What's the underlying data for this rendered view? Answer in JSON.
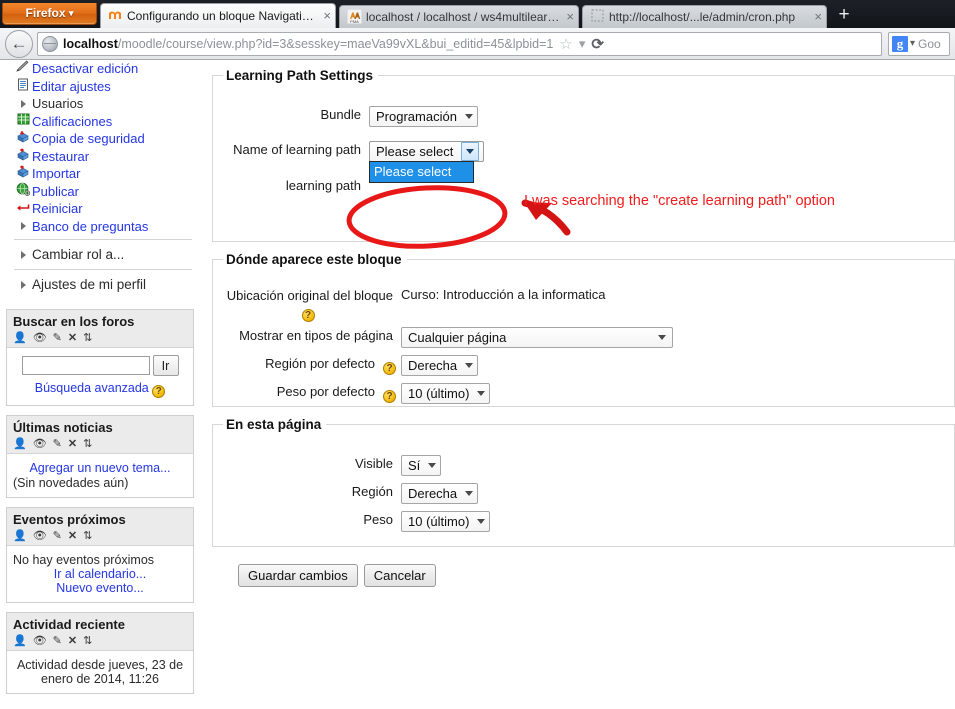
{
  "browser": {
    "app_button": {
      "label": "Firefox",
      "caret": "▾"
    },
    "tabs": [
      {
        "title": "Configurando un bloque Navigation ...",
        "favicon": "moodle-icon",
        "active": true,
        "close": "×"
      },
      {
        "title": "localhost / localhost / ws4multilearni...",
        "favicon": "phpmyadmin-icon",
        "active": false,
        "close": "×"
      },
      {
        "title": "http://localhost/...le/admin/cron.php",
        "favicon": "blank-page-icon",
        "active": false,
        "close": "×"
      }
    ],
    "new_tab_label": "+",
    "back_button": "←",
    "url": {
      "host": "localhost",
      "path": "/moodle/course/view.php?id=3&sesskey=maeVa99vXL&bui_editid=45&lpbid=1"
    },
    "url_icons": {
      "bookmark": "☆",
      "dropmarker": "▾",
      "reload": "⟳"
    },
    "search": {
      "engine": "g",
      "engine_caret": "▾",
      "placeholder": "Goo"
    }
  },
  "sidebar": {
    "nav_items": [
      {
        "label": "Desactivar edición",
        "icon": "pencil-edit-icon",
        "link": true,
        "expander": false
      },
      {
        "label": "Editar ajustes",
        "icon": "document-settings-icon",
        "link": true,
        "expander": false
      },
      {
        "label": "Usuarios",
        "icon": "expand-arrow-icon",
        "link": false,
        "expander": true
      },
      {
        "label": "Calificaciones",
        "icon": "grades-grid-icon",
        "link": true,
        "expander": false
      },
      {
        "label": "Copia de seguridad",
        "icon": "backup-box-icon",
        "link": true,
        "expander": false
      },
      {
        "label": "Restaurar",
        "icon": "restore-box-icon",
        "link": true,
        "expander": false
      },
      {
        "label": "Importar",
        "icon": "import-box-icon",
        "link": true,
        "expander": false
      },
      {
        "label": "Publicar",
        "icon": "globe-publish-icon",
        "link": true,
        "expander": false
      },
      {
        "label": "Reiniciar",
        "icon": "reset-arrow-icon",
        "link": true,
        "expander": false
      },
      {
        "label": "Banco de preguntas",
        "icon": "expand-arrow-icon",
        "link": true,
        "expander": true
      }
    ],
    "nav_sections": [
      {
        "label": "Cambiar rol a...",
        "icon": "expand-arrow-icon"
      },
      {
        "label": "Ajustes de mi perfil",
        "icon": "expand-arrow-icon"
      }
    ],
    "block_action_icons": [
      "assign-roles-icon",
      "hide-eye-icon",
      "configure-icon",
      "delete-x-icon",
      "move-icon"
    ],
    "blocks": [
      {
        "title": "Buscar en los foros",
        "type": "search",
        "search_value": "",
        "go_label": "Ir",
        "advanced_link": "Búsqueda avanzada",
        "help_glyph": "?"
      },
      {
        "title": "Últimas noticias",
        "type": "news",
        "add_topic_link": "Agregar un nuevo tema...",
        "empty_text": "(Sin novedades aún)"
      },
      {
        "title": "Eventos próximos",
        "type": "events",
        "empty_text": "No hay eventos próximos",
        "links": [
          "Ir al calendario...",
          "Nuevo evento..."
        ]
      },
      {
        "title": "Actividad reciente",
        "type": "activity",
        "since_text": "Actividad desde jueves, 23 de enero de 2014, 11:26"
      }
    ]
  },
  "main": {
    "sections": [
      {
        "legend": "Learning Path Settings",
        "rows": [
          {
            "label": "Bundle",
            "control": "select",
            "value": "Programación"
          },
          {
            "label": "Name of learning path",
            "control": "select-open",
            "value": "Please select",
            "open_option": "Please select"
          },
          {
            "label": "learning path",
            "control": "none",
            "value": ""
          }
        ]
      },
      {
        "legend": "Dónde aparece este bloque",
        "rows": [
          {
            "label": "Ubicación original del bloque",
            "control": "static",
            "value": "Curso: Introducción a la informatica",
            "help": "?"
          },
          {
            "label": "Mostrar en tipos de página",
            "control": "select-wide",
            "value": "Cualquier página"
          },
          {
            "label": "Región por defecto",
            "control": "select",
            "value": "Derecha",
            "help": "?"
          },
          {
            "label": "Peso por defecto",
            "control": "select",
            "value": "10 (último)",
            "help": "?"
          }
        ]
      },
      {
        "legend": "En esta página",
        "rows": [
          {
            "label": "Visible",
            "control": "select",
            "value": "Sí"
          },
          {
            "label": "Región",
            "control": "select",
            "value": "Derecha"
          },
          {
            "label": "Peso",
            "control": "select",
            "value": "10 (último)"
          }
        ]
      }
    ],
    "buttons": {
      "save": "Guardar cambios",
      "cancel": "Cancelar"
    }
  },
  "annotation": {
    "text": "I was searching the \"create learning path\" option",
    "color": "#f21c1c",
    "shapes": [
      "ellipse-highlight",
      "arrow"
    ]
  }
}
